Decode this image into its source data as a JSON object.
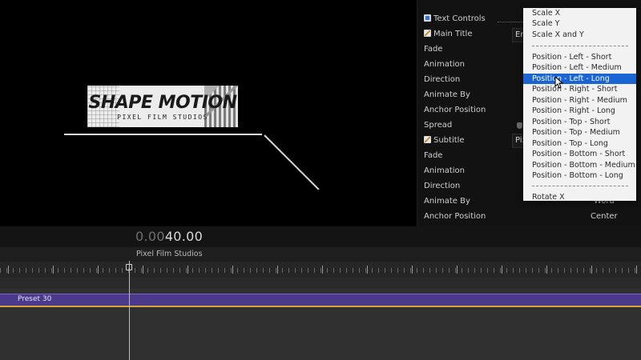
{
  "viewer": {
    "logo_title": "SHAPE MOTION",
    "logo_subtitle": "PIXEL FILM STUDIOS"
  },
  "inspector": {
    "rows": [
      {
        "label": "Text Controls"
      },
      {
        "label": "Main Title",
        "value": "En"
      },
      {
        "label": "Fade"
      },
      {
        "label": "Animation"
      },
      {
        "label": "Direction"
      },
      {
        "label": "Animate By"
      },
      {
        "label": "Anchor Position"
      },
      {
        "label": "Spread"
      },
      {
        "label": "Subtitle",
        "value": "Pix"
      },
      {
        "label": "Fade"
      },
      {
        "label": "Animation"
      },
      {
        "label": "Direction"
      },
      {
        "label": "Animate By",
        "value": "Word"
      },
      {
        "label": "Anchor Position",
        "value": "Center"
      }
    ]
  },
  "dropdown": {
    "items": [
      "Scale X",
      "Scale Y",
      "Scale X and Y",
      "Position - Left - Short",
      "Position - Left - Medium",
      "Position - Left - Long",
      "Position - Right - Short",
      "Position - Right - Medium",
      "Position - Right - Long",
      "Position - Top - Short",
      "Position - Top - Medium",
      "Position - Top - Long",
      "Position - Bottom - Short",
      "Position - Bottom - Medium",
      "Position - Bottom - Long",
      "Rotate X"
    ],
    "selected": "Position - Left - Long"
  },
  "timeline": {
    "timecode_dim": "0.00",
    "timecode_bright": "40.00",
    "project_name": "Pixel Film Studios",
    "clip_name": "Preset 30"
  },
  "colors": {
    "selection": "#1b64d4",
    "clip": "#4b3a8c",
    "clip_edge": "#d9a23a"
  }
}
